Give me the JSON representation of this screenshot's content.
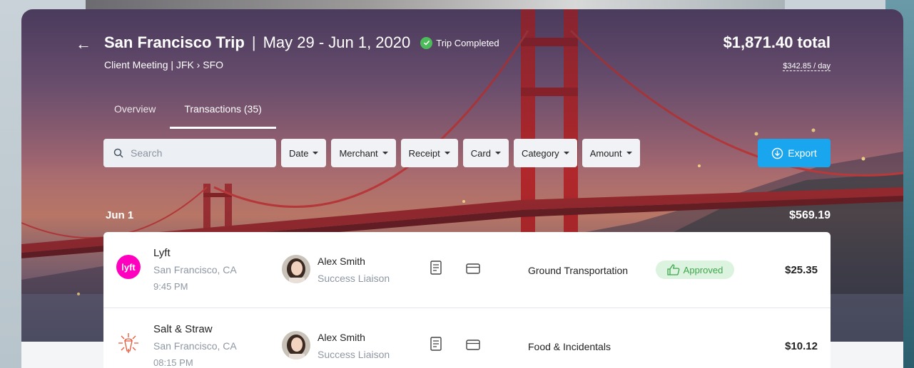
{
  "trip": {
    "name": "San Francisco Trip",
    "separator": "|",
    "dates": "May 29 - Jun 1, 2020",
    "status": "Trip Completed",
    "subtitle": "Client Meeting  |  JFK › SFO",
    "total": "$1,871.40 total",
    "per_day": "$342.85 / day"
  },
  "tabs": [
    {
      "label": "Overview",
      "active": false
    },
    {
      "label": "Transactions (35)",
      "active": true
    }
  ],
  "search": {
    "placeholder": "Search",
    "value": ""
  },
  "filters": [
    "Date",
    "Merchant",
    "Receipt",
    "Card",
    "Category",
    "Amount"
  ],
  "export_label": "Export",
  "day": {
    "label": "Jun 1",
    "total": "$569.19"
  },
  "transactions": [
    {
      "merchant": "Lyft",
      "location": "San Francisco, CA",
      "time": "9:45 PM",
      "person": "Alex Smith",
      "role": "Success Liaison",
      "category": "Ground Transportation",
      "status": "Approved",
      "amount": "$25.35",
      "logo": "lyft-logo"
    },
    {
      "merchant": "Salt & Straw",
      "location": "San Francisco, CA",
      "time": "08:15 PM",
      "person": "Alex Smith",
      "role": "Success Liaison",
      "category": "Food & Incidentals",
      "status": "",
      "amount": "$10.12",
      "logo": "salt-straw-logo"
    }
  ],
  "colors": {
    "accent": "#1aa6ee",
    "approved_bg": "#dcf3df",
    "approved_text": "#3fa54c",
    "lyft": "#ff00bf",
    "check": "#4cbb5a"
  }
}
